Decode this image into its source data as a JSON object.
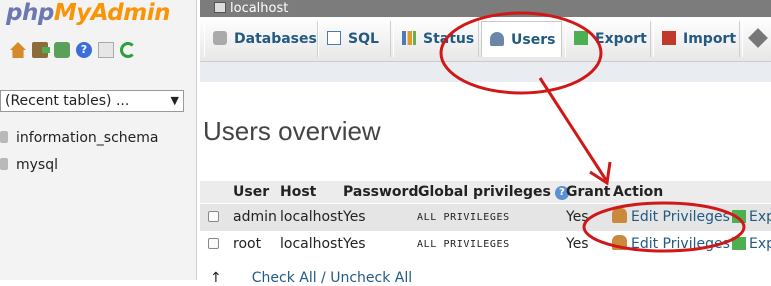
{
  "logo": {
    "part1": "php",
    "part2": "MyAdmin"
  },
  "nav": {
    "icons": [
      "home-icon",
      "logout-icon",
      "sql-query-icon",
      "help-icon",
      "docs-icon",
      "reload-icon"
    ],
    "recent_tables": "(Recent tables) ...",
    "databases": [
      "information_schema",
      "mysql"
    ]
  },
  "server": {
    "name": "localhost"
  },
  "tabs": [
    {
      "label": "Databases",
      "icon": "database-icon"
    },
    {
      "label": "SQL",
      "icon": "sql-icon"
    },
    {
      "label": "Status",
      "icon": "status-icon"
    },
    {
      "label": "Users",
      "icon": "users-icon",
      "active": true
    },
    {
      "label": "Export",
      "icon": "export-icon"
    },
    {
      "label": "Import",
      "icon": "import-icon"
    },
    {
      "label": "",
      "icon": "settings-icon"
    }
  ],
  "page_title": "Users overview",
  "table": {
    "headers": [
      "User",
      "Host",
      "Password",
      "Global privileges",
      "Grant",
      "Action"
    ],
    "rows": [
      {
        "user": "admin",
        "host": "localhost",
        "password": "Yes",
        "privileges": "ALL PRIVILEGES",
        "grant": "Yes",
        "edit": "Edit Privileges",
        "export": "Exp"
      },
      {
        "user": "root",
        "host": "localhost",
        "password": "Yes",
        "privileges": "ALL PRIVILEGES",
        "grant": "Yes",
        "edit": "Edit Privileges",
        "export": "Exp"
      }
    ]
  },
  "footer": {
    "arrow": "↑",
    "check_all": "Check All / Uncheck All"
  },
  "colors": {
    "link": "#235a81",
    "annotation": "#d01818",
    "logo_php": "#6c78af",
    "logo_admin": "#f89406"
  }
}
